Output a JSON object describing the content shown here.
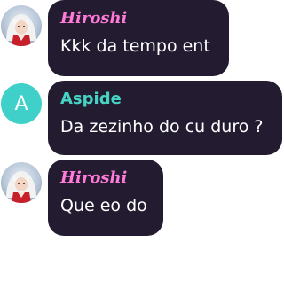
{
  "messages": [
    {
      "author": "Hiroshi",
      "text": "Kkk da tempo ent",
      "avatar_icon": "anime-character-avatar-icon",
      "name_color": "#ff7ad9"
    },
    {
      "author": "Aspide",
      "avatar_letter": "A",
      "text": "Da zezinho do cu duro ?",
      "avatar_color": "#3fd0c9",
      "name_color": "#45d4c4"
    },
    {
      "author": "Hiroshi",
      "text": "Que eo do",
      "avatar_icon": "anime-character-avatar-icon",
      "name_color": "#ff7ad9"
    }
  ],
  "colors": {
    "bubble_background": "#231c31",
    "message_text": "#ffffff",
    "page_background": "#ffffff"
  }
}
